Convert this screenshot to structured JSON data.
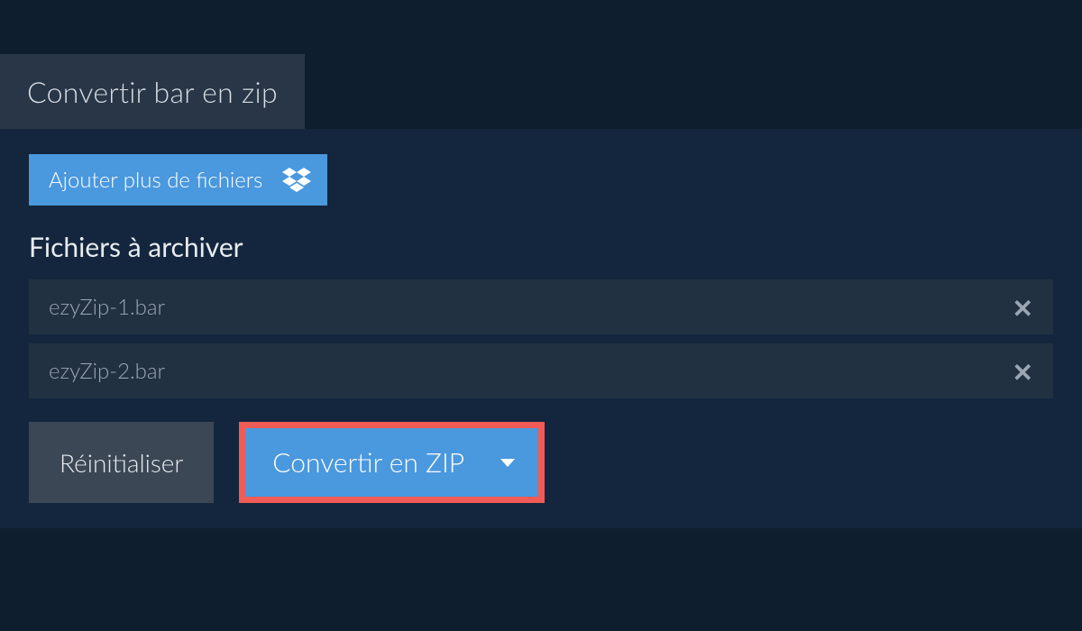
{
  "tab": {
    "title": "Convertir bar en zip"
  },
  "addFiles": {
    "label": "Ajouter plus de fichiers"
  },
  "section": {
    "heading": "Fichiers à archiver"
  },
  "files": [
    {
      "name": "ezyZip-1.bar"
    },
    {
      "name": "ezyZip-2.bar"
    }
  ],
  "buttons": {
    "reset": "Réinitialiser",
    "convert": "Convertir en ZIP"
  }
}
